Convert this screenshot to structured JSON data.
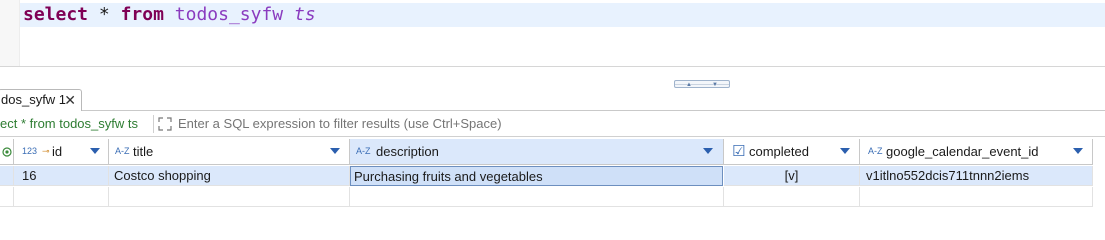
{
  "editor": {
    "sql_keyword_select": "select",
    "sql_star": "*",
    "sql_keyword_from": "from",
    "sql_table": "todos_syfw",
    "sql_alias": "ts"
  },
  "result_tab": {
    "label": "dos_syfw 1",
    "close_glyph": "✕"
  },
  "filter": {
    "query_text": "ect * from todos_syfw ts",
    "placeholder": "Enter a SQL expression to filter results (use Ctrl+Space)"
  },
  "grid": {
    "columns": [
      {
        "type_label": "123",
        "name": "id"
      },
      {
        "type_label": "A-Z",
        "name": "title"
      },
      {
        "type_label": "A-Z",
        "name": "description"
      },
      {
        "type_label": "☑",
        "name": "completed"
      },
      {
        "type_label": "A-Z",
        "name": "google_calendar_event_id"
      }
    ],
    "rows": [
      {
        "id": "16",
        "title": "Costco shopping",
        "description": "Purchasing fruits and vegetables",
        "completed": "[v]",
        "google_calendar_event_id": "v1itlno552dcis711tnnn2iems"
      }
    ]
  },
  "colors": {
    "selection": "#dbe8fb",
    "keyword": "#7f0055",
    "identifier": "#8a3bbf",
    "filter_query": "#2e7d32"
  }
}
